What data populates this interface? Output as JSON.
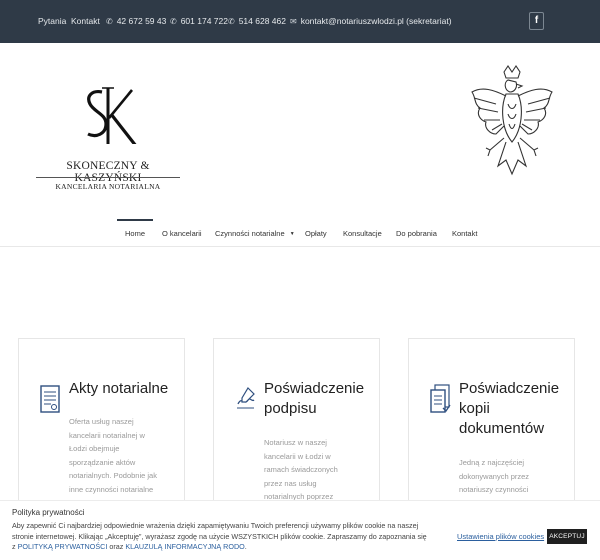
{
  "topbar": {
    "links": [
      "Pytania",
      "Kontakt"
    ],
    "phones": [
      "42 672 59 43",
      "601 174 722",
      "514 628 462"
    ],
    "email": "kontakt@notariuszwlodzi.pl (sekretariat)",
    "facebook": "f"
  },
  "logo": {
    "firm": "SKONECZNY & KASZYŃSKI",
    "subtitle": "KANCELARIA NOTARIALNA"
  },
  "nav": {
    "items": [
      "Home",
      "O kancelarii",
      "Czynności notarialne",
      "Opłaty",
      "Konsultacje",
      "Do pobrania",
      "Kontakt"
    ],
    "dropdown_caret": "▼",
    "active": "Home"
  },
  "cards": [
    {
      "icon": "document-icon",
      "title_lines": [
        "Akty notarialne"
      ],
      "desc_lines": [
        "Oferta usług naszej",
        "kancelarii notarialnej w",
        "Łodzi obejmuje",
        "sporządzanie aktów",
        "notarialnych. Podobnie jak",
        "inne czynności notarialne"
      ]
    },
    {
      "icon": "signature-icon",
      "title_lines": [
        "Poświadczenie",
        "podpisu"
      ],
      "desc_lines": [
        "Notariusz w naszej",
        "kancelarii w Łodzi w",
        "ramach świadczonych",
        "przez nas usług",
        "notarialnych poprzez"
      ]
    },
    {
      "icon": "copy-document-icon",
      "title_lines": [
        "Poświadczenie",
        "kopii",
        "dokumentów"
      ],
      "desc_lines": [
        "Jedną z najczęściej",
        "dokonywanych przez",
        "notariuszy czynności"
      ]
    }
  ],
  "cookie": {
    "title": "Polityka prywatności",
    "line1": "Aby zapewnić Ci najbardziej odpowiednie wrażenia dzięki zapamiętywaniu Twoich preferencji używamy plików cookie na naszej",
    "line2": "stronie internetowej. Klikając „Akceptuję”, wyrażasz zgodę na użycie WSZYSTKICH plików cookie. Zapraszamy do zapoznania się",
    "line3_prefix": "z",
    "policy_link": "POLITYKĄ PRYWATNOŚCI",
    "line3_mid": "oraz",
    "clause_link": "KLAUZULĄ INFORMACYJNĄ RODO",
    "settings_label": "Ustawienia plików cookies",
    "accept_label": "AKCEPTUJ"
  },
  "colors": {
    "topbar_bg": "#2f3a47",
    "link": "#2b5f9e",
    "accept_bg": "#1f1f1f"
  }
}
